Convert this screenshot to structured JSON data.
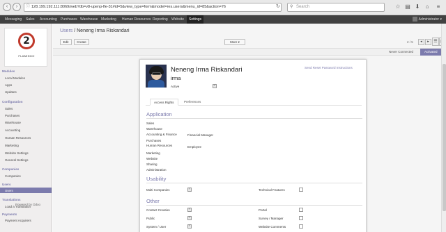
{
  "browser": {
    "url": "128.199.192.111:8069/web?db=v8-upenp-fle-31#id=5&view_type=form&model=res.users&menu_id=85&action=76",
    "search_placeholder": "Search"
  },
  "topnav": {
    "items": [
      "Messaging",
      "Sales",
      "Accounting",
      "Purchases",
      "Warehouse",
      "Marketing",
      "Human Resources",
      "Reporting",
      "Website",
      "Settings"
    ],
    "active": "Settings",
    "user": "Administrator"
  },
  "sidebar": {
    "logo_text": "FLAMINGO",
    "sections": [
      {
        "title": "Modules",
        "items": [
          "Local Modules",
          "Apps",
          "Updates"
        ]
      },
      {
        "title": "Configuration",
        "items": [
          "Sales",
          "Purchases",
          "Warehouse",
          "Accounting",
          "Human Resources",
          "Marketing",
          "Website Settings",
          "General Settings"
        ]
      },
      {
        "title": "Companies",
        "items": [
          "Companies"
        ]
      },
      {
        "title": "Users",
        "items": [
          "Users"
        ]
      },
      {
        "title": "Translations",
        "items": [
          "Load a Translation"
        ]
      },
      {
        "title": "Payments",
        "items": [
          "Payment Acquirers"
        ]
      }
    ],
    "active_item": "Users",
    "powered_by": "Powered by Odoo"
  },
  "header": {
    "breadcrumb_parent": "Users",
    "breadcrumb_sep": " / ",
    "breadcrumb_current": "Neneng Irma Riskandari",
    "edit_label": "Edit",
    "create_label": "Create",
    "more_label": "More ▾",
    "pager": "2 / 5"
  },
  "statusbar": {
    "steps": [
      "Never Connected",
      "Activated"
    ],
    "active": "Activated"
  },
  "form": {
    "name": "Neneng Irma Riskandari",
    "login": "irma",
    "active_label": "Active",
    "active_checked": true,
    "reset_link": "Send Reset Password Instructions",
    "tabs": [
      "Access Rights",
      "Preferences"
    ],
    "active_tab": "Access Rights",
    "application_title": "Application",
    "application_rows": [
      {
        "label": "Sales",
        "value": ""
      },
      {
        "label": "Warehouse",
        "value": ""
      },
      {
        "label": "Accounting & Finance",
        "value": "Financial Manager"
      },
      {
        "label": "Purchases",
        "value": ""
      },
      {
        "label": "Human Resources",
        "value": "Employee"
      },
      {
        "label": "Marketing",
        "value": ""
      },
      {
        "label": "Website",
        "value": ""
      },
      {
        "label": "Sharing",
        "value": ""
      },
      {
        "label": "Administration",
        "value": ""
      }
    ],
    "usability_title": "Usability",
    "usability": [
      {
        "label": "Multi Companies",
        "checked": true
      },
      {
        "label": "Technical Features",
        "checked": false
      }
    ],
    "other_title": "Other",
    "other": [
      {
        "label": "Contact Creation",
        "checked": true
      },
      {
        "label": "Portal",
        "checked": false
      },
      {
        "label": "Public",
        "checked": true
      },
      {
        "label": "Survey / Manager",
        "checked": false
      },
      {
        "label": "System / User",
        "checked": true
      },
      {
        "label": "Website Comments",
        "checked": false
      }
    ]
  },
  "colors": {
    "accent": "#7c7bad",
    "topnav": "#414141"
  }
}
